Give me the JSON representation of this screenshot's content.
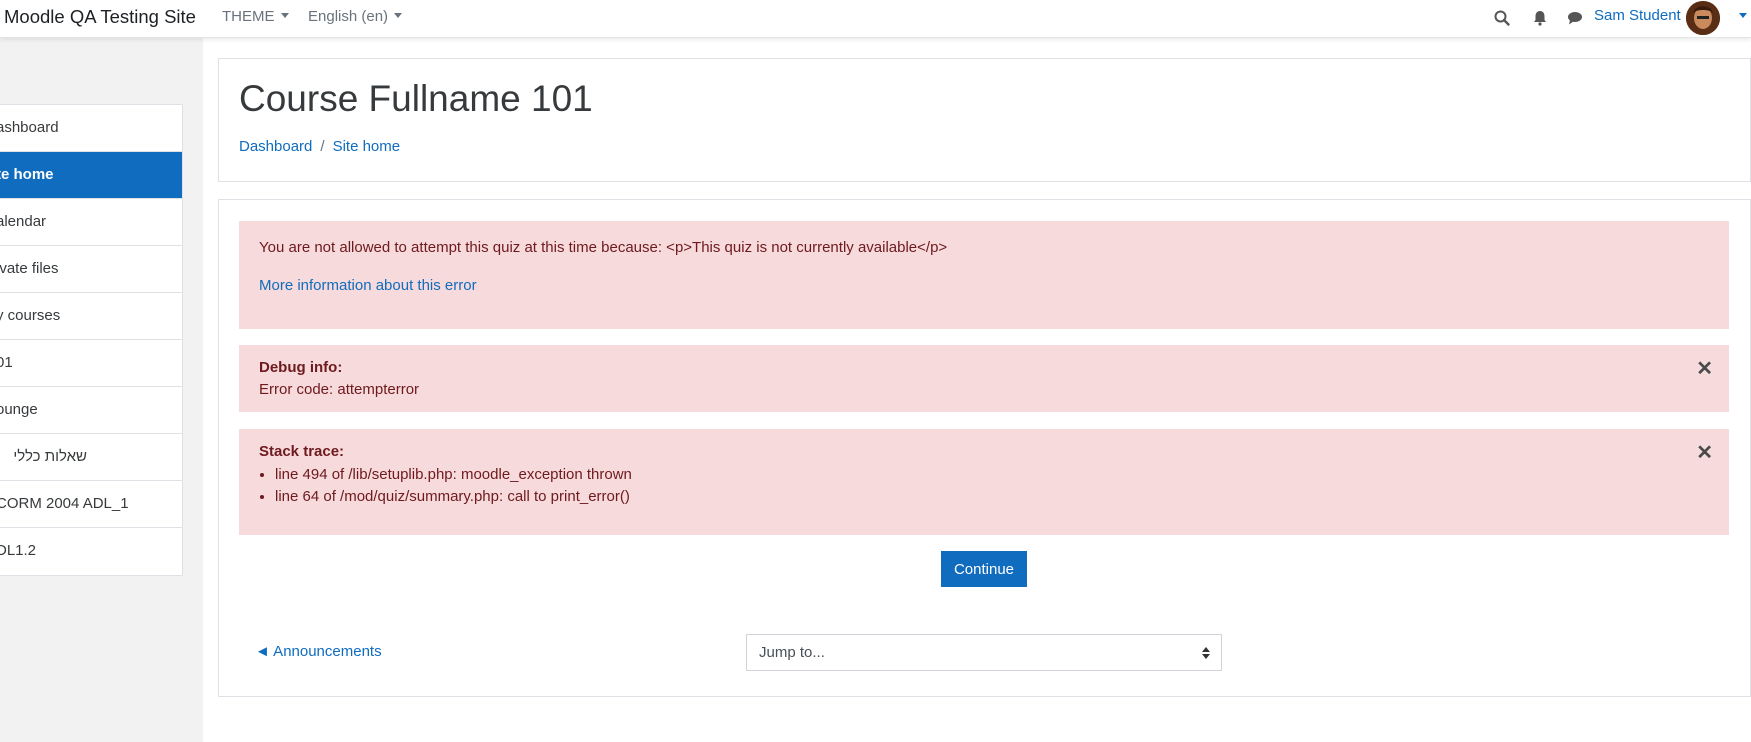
{
  "navbar": {
    "brand": "Moodle QA Testing Site",
    "theme_menu": "THEME",
    "language_menu": "English (en)",
    "user_name": "Sam Student"
  },
  "sidebar": {
    "items": [
      {
        "label": "ashboard",
        "active": false
      },
      {
        "label": "te home",
        "active": true
      },
      {
        "label": "alendar",
        "active": false
      },
      {
        "label": "ivate files",
        "active": false
      },
      {
        "label": "y courses",
        "active": false
      },
      {
        "label": "01",
        "active": false
      },
      {
        "label": "ounge",
        "active": false
      },
      {
        "label": "שאלות כללי",
        "active": false
      },
      {
        "label": "CORM 2004 ADL_1",
        "active": false
      },
      {
        "label": "DL1.2",
        "active": false
      }
    ]
  },
  "header": {
    "title": "Course Fullname 101",
    "breadcrumb": [
      "Dashboard",
      "Site home"
    ],
    "breadcrumb_separator": "/"
  },
  "error": {
    "message": "You are not allowed to attempt this quiz at this time because: <p>This quiz is not currently available</p>",
    "more_info_link": "More information about this error"
  },
  "debug": {
    "title": "Debug info:",
    "error_code": "Error code: attempterror"
  },
  "stack": {
    "title": "Stack trace:",
    "lines": [
      "line 494 of /lib/setuplib.php: moodle_exception thrown",
      "line 64 of /mod/quiz/summary.php: call to print_error()"
    ]
  },
  "actions": {
    "continue_label": "Continue",
    "prev_activity": "◄ Announcements",
    "jump_placeholder": "Jump to..."
  },
  "colors": {
    "primary": "#0f6cbf",
    "alert_bg": "#f7dadb",
    "alert_text": "#6e1a1e"
  }
}
